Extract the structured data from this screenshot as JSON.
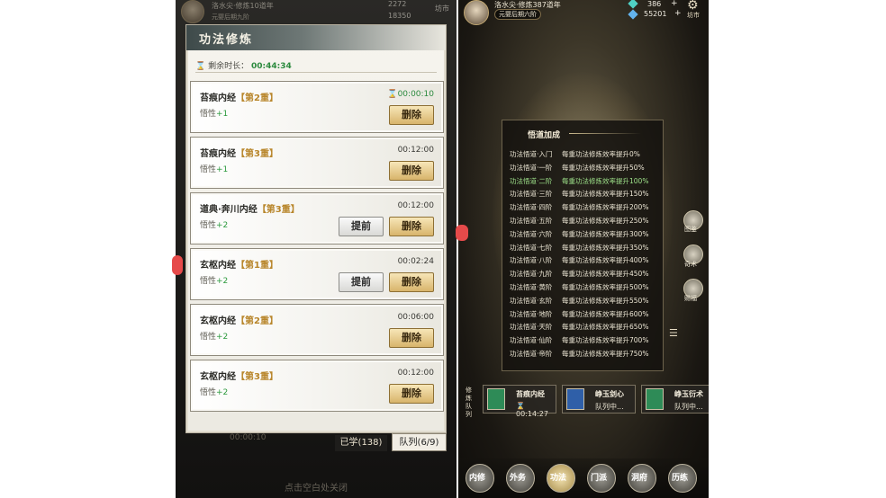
{
  "left": {
    "topbar": {
      "name": "洛水尖·修炼10道年",
      "realm": "元婴后期九阶",
      "resource1": "2272",
      "resource2": "18350",
      "shop": "坊市"
    },
    "panel": {
      "title": "功法修炼",
      "remaining_label": "剩余时长：",
      "remaining_value": "00:44:34",
      "cards": [
        {
          "name": "苔痕内经",
          "tier": "【第2重】",
          "attr_label": "悟性",
          "attr_value": "+1",
          "time": "00:00:10",
          "active": true,
          "advance": false
        },
        {
          "name": "苔痕内经",
          "tier": "【第3重】",
          "attr_label": "悟性",
          "attr_value": "+1",
          "time": "00:12:00",
          "active": false,
          "advance": false
        },
        {
          "name": "道典·奔川内经",
          "tier": "【第3重】",
          "attr_label": "悟性",
          "attr_value": "+2",
          "time": "00:12:00",
          "active": false,
          "advance": true
        },
        {
          "name": "玄枢内经",
          "tier": "【第1重】",
          "attr_label": "悟性",
          "attr_value": "+2",
          "time": "00:02:24",
          "active": false,
          "advance": true
        },
        {
          "name": "玄枢内经",
          "tier": "【第2重】",
          "attr_label": "悟性",
          "attr_value": "+2",
          "time": "00:06:00",
          "active": false,
          "advance": false
        },
        {
          "name": "玄枢内经",
          "tier": "【第3重】",
          "attr_label": "悟性",
          "attr_value": "+2",
          "time": "00:12:00",
          "active": false,
          "advance": false
        }
      ],
      "delete_label": "删除",
      "advance_label": "提前"
    },
    "tabs": {
      "learned": "已学(138)",
      "queue": "队列(6/9)"
    },
    "dim_time": "00:00:10",
    "close_hint": "点击空白处关闭"
  },
  "right": {
    "topbar": {
      "name": "洛水尖·修炼387道年",
      "realm": "元婴后期六阶",
      "resource1": "386",
      "resource2": "55201",
      "plus": "+",
      "shop": "坊市"
    },
    "bonus": {
      "title": "悟道加成",
      "rows": [
        {
          "level": "功法悟道·入门",
          "effect": "每重功法修炼效率提升0%",
          "highlight": false
        },
        {
          "level": "功法悟道·一阶",
          "effect": "每重功法修炼效率提升50%",
          "highlight": false
        },
        {
          "level": "功法悟道·二阶",
          "effect": "每重功法修炼效率提升100%",
          "highlight": true
        },
        {
          "level": "功法悟道·三阶",
          "effect": "每重功法修炼效率提升150%",
          "highlight": false
        },
        {
          "level": "功法悟道·四阶",
          "effect": "每重功法修炼效率提升200%",
          "highlight": false
        },
        {
          "level": "功法悟道·五阶",
          "effect": "每重功法修炼效率提升250%",
          "highlight": false
        },
        {
          "level": "功法悟道·六阶",
          "effect": "每重功法修炼效率提升300%",
          "highlight": false
        },
        {
          "level": "功法悟道·七阶",
          "effect": "每重功法修炼效率提升350%",
          "highlight": false
        },
        {
          "level": "功法悟道·八阶",
          "effect": "每重功法修炼效率提升400%",
          "highlight": false
        },
        {
          "level": "功法悟道·九阶",
          "effect": "每重功法修炼效率提升450%",
          "highlight": false
        },
        {
          "level": "功法悟道·黄阶",
          "effect": "每重功法修炼效率提升500%",
          "highlight": false
        },
        {
          "level": "功法悟道·玄阶",
          "effect": "每重功法修炼效率提升550%",
          "highlight": false
        },
        {
          "level": "功法悟道·地阶",
          "effect": "每重功法修炼效率提升600%",
          "highlight": false
        },
        {
          "level": "功法悟道·天阶",
          "effect": "每重功法修炼效率提升650%",
          "highlight": false
        },
        {
          "level": "功法悟道·仙阶",
          "effect": "每重功法修炼效率提升700%",
          "highlight": false
        },
        {
          "level": "功法悟道·帝阶",
          "effect": "每重功法修炼效率提升750%",
          "highlight": false
        }
      ]
    },
    "side": {
      "atlas": "图鉴",
      "technique": "奇术",
      "blessing": "赐福"
    },
    "queue_label": "修炼队列",
    "queue": [
      {
        "name": "苔痕内经",
        "state": "00:14:27",
        "book_color": "#2e8b57"
      },
      {
        "name": "峥玉剑心",
        "state": "队列中...",
        "book_color": "#2f5fa8"
      },
      {
        "name": "峥玉衍术",
        "state": "队列中...",
        "book_color": "#2e8b57"
      }
    ],
    "dock": [
      "内修",
      "外务",
      "功法",
      "门派",
      "洞府",
      "历练"
    ]
  },
  "colors": {
    "accent_gold": "#d8b46b",
    "active_green": "#2b8a3e",
    "highlight_green": "#9ee28a"
  }
}
